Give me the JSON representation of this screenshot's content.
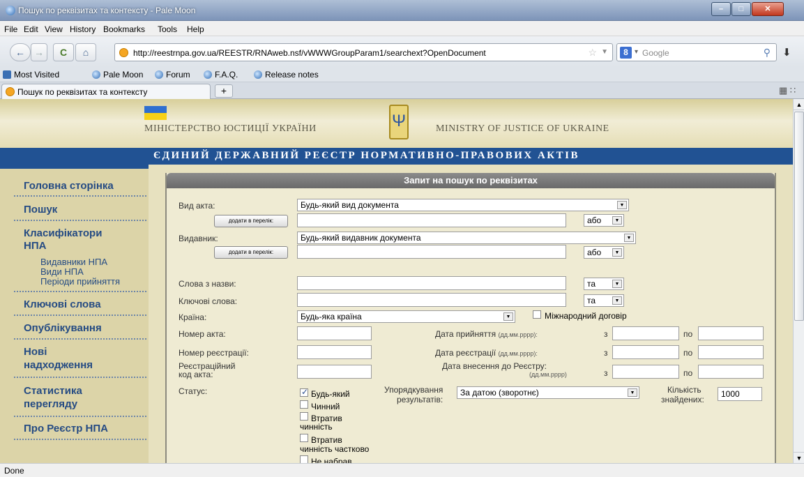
{
  "window": {
    "title": "Пошук по реквізитах та контексту - Pale Moon"
  },
  "menu": [
    "File",
    "Edit",
    "View",
    "History",
    "Bookmarks",
    "Tools",
    "Help"
  ],
  "nav": {
    "url": "http://reestrnpa.gov.ua/REESTR/RNAweb.nsf/vWWWGroupParam1/searchext?OpenDocument",
    "search_placeholder": "Google"
  },
  "bookmarks": [
    "Most Visited",
    "Pale Moon",
    "Forum",
    "F.A.Q.",
    "Release notes"
  ],
  "tab": {
    "title": "Пошук по реквізитах та контексту",
    "new_tab": "+"
  },
  "header": {
    "ministry_ua": "МІНІСТЕРСТВО ЮСТИЦІЇ УКРАЇНИ",
    "ministry_en": "MINISTRY OF JUSTICE OF UKRAINE",
    "banner": "ЄДИНИЙ ДЕРЖАВНИЙ РЕЄСТР НОРМАТИВНО-ПРАВОВИХ АКТІВ"
  },
  "sidebar": {
    "home": "Головна сторінка",
    "search": "Пошук",
    "classifiers": [
      "Класифікатори",
      "НПА"
    ],
    "sub": [
      "Видавники НПА",
      "Види НПА",
      "Періоди прийняття"
    ],
    "keywords": "Ключові слова",
    "publication": "Опублікування",
    "new_arrivals": [
      "Нові",
      "надходження"
    ],
    "stats": [
      "Статистика",
      "перегляду"
    ],
    "about": "Про Реєстр НПА"
  },
  "form": {
    "title": "Запит на пошук по реквізитах",
    "act_type_label": "Вид акта:",
    "act_type_value": "Будь-який вид документа",
    "add_button": "додати в перелік:",
    "or": "або",
    "and": "та",
    "publisher_label": "Видавник:",
    "publisher_value": "Будь-який видавник документа",
    "title_words_label": "Слова з назви:",
    "keywords_label": "Ключові слова:",
    "country_label": "Країна:",
    "country_value": "Будь-яка країна",
    "intl_treaty": "Міжнародний договір",
    "act_number_label": "Номер акта:",
    "reg_number_label": "Номер реєстрації:",
    "reg_code_label": [
      "Реєстраційний",
      "код акта:"
    ],
    "adopt_date_label": "Дата прийняття",
    "reg_date_label": "Дата реєстрації",
    "entry_date_label": "Дата внесення до Реєстру:",
    "date_format": "(дд.мм.рррр):",
    "date_format2": "(дд.мм.рррр)",
    "from": "з",
    "to": "по",
    "status_label": "Статус:",
    "statuses": [
      "Будь-який",
      "Чинний",
      "Втратив",
      "чинність",
      "Втратив",
      "чинність частково",
      "Не набрав"
    ],
    "sort_label": [
      "Упорядкування",
      "результатів:"
    ],
    "sort_value": "За датою (зворотнє)",
    "count_label": [
      "Кількість",
      "знайдених:"
    ],
    "count_value": "1000"
  },
  "status": "Done"
}
